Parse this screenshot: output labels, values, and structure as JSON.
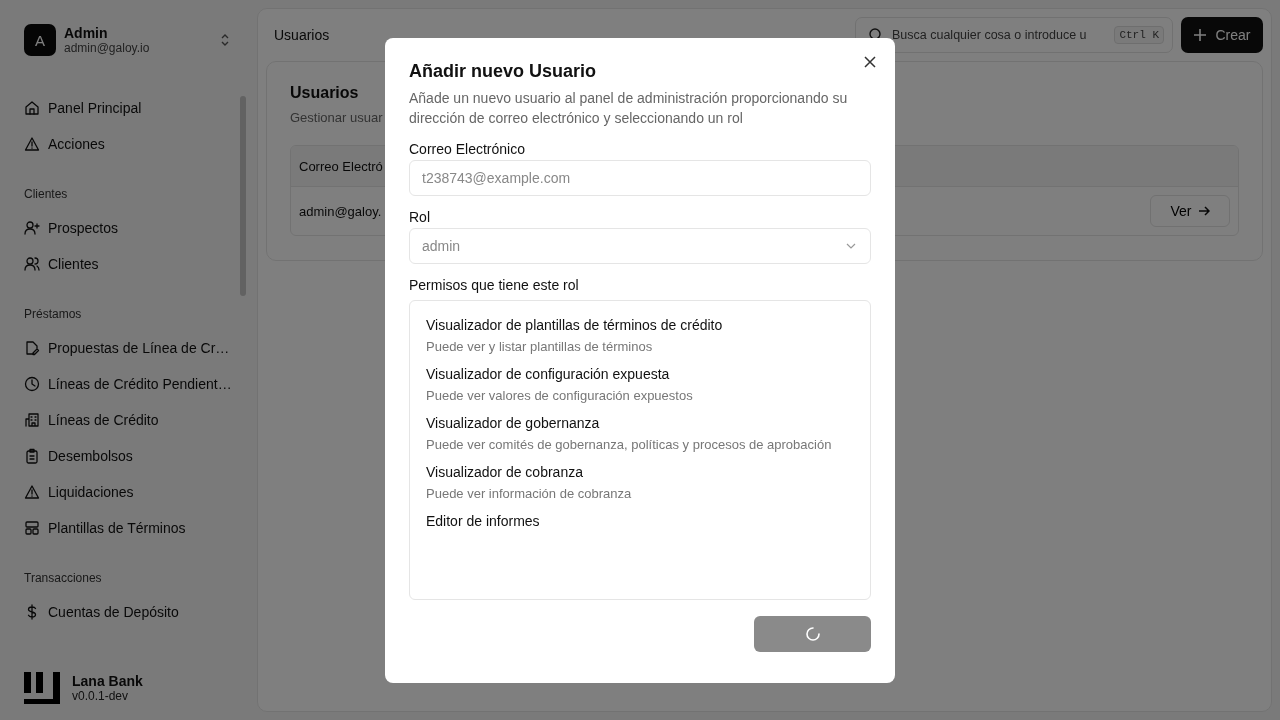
{
  "account": {
    "initial": "A",
    "name": "Admin",
    "email": "admin@galoy.io"
  },
  "sidebar": {
    "groups": [
      {
        "items": [
          {
            "label": "Panel Principal"
          },
          {
            "label": "Acciones"
          }
        ]
      },
      {
        "title": "Clientes",
        "items": [
          {
            "label": "Prospectos"
          },
          {
            "label": "Clientes"
          }
        ]
      },
      {
        "title": "Préstamos",
        "items": [
          {
            "label": "Propuestas de Línea de Cr…"
          },
          {
            "label": "Líneas de Crédito Pendient…"
          },
          {
            "label": "Líneas de Crédito"
          },
          {
            "label": "Desembolsos"
          },
          {
            "label": "Liquidaciones"
          },
          {
            "label": "Plantillas de Términos"
          }
        ]
      },
      {
        "title": "Transacciones",
        "items": [
          {
            "label": "Cuentas de Depósito"
          }
        ]
      }
    ]
  },
  "brand": {
    "name": "Lana Bank",
    "version": "v0.0.1-dev"
  },
  "header": {
    "breadcrumb": "Usuarios",
    "search": {
      "placeholder": "Busca cualquier cosa o introduce u",
      "shortcut": "Ctrl K"
    },
    "create_button": "Crear"
  },
  "card": {
    "title": "Usuarios",
    "subtitle": "Gestionar usuar",
    "table": {
      "columns": [
        "Correo Electró"
      ],
      "rows": [
        {
          "cells": [
            "admin@galoy."
          ],
          "action": "Ver"
        }
      ]
    }
  },
  "dialog": {
    "title": "Añadir nuevo Usuario",
    "description": "Añade un nuevo usuario al panel de administración proporcionando su dirección de correo electrónico y seleccionando un rol",
    "email": {
      "label": "Correo Electrónico",
      "placeholder": "t238743@example.com"
    },
    "role": {
      "label": "Rol",
      "value": "admin",
      "disabled": true
    },
    "permissions": {
      "label": "Permisos que tiene este rol",
      "items": [
        {
          "title": "Visualizador de plantillas de términos de crédito",
          "description": "Puede ver y listar plantillas de términos"
        },
        {
          "title": "Visualizador de configuración expuesta",
          "description": "Puede ver valores de configuración expuestos"
        },
        {
          "title": "Visualizador de gobernanza",
          "description": "Puede ver comités de gobernanza, políticas y procesos de aprobación"
        },
        {
          "title": "Visualizador de cobranza",
          "description": "Puede ver información de cobranza"
        },
        {
          "title": "Editor de informes"
        }
      ]
    },
    "submit": {
      "loading": true
    }
  }
}
